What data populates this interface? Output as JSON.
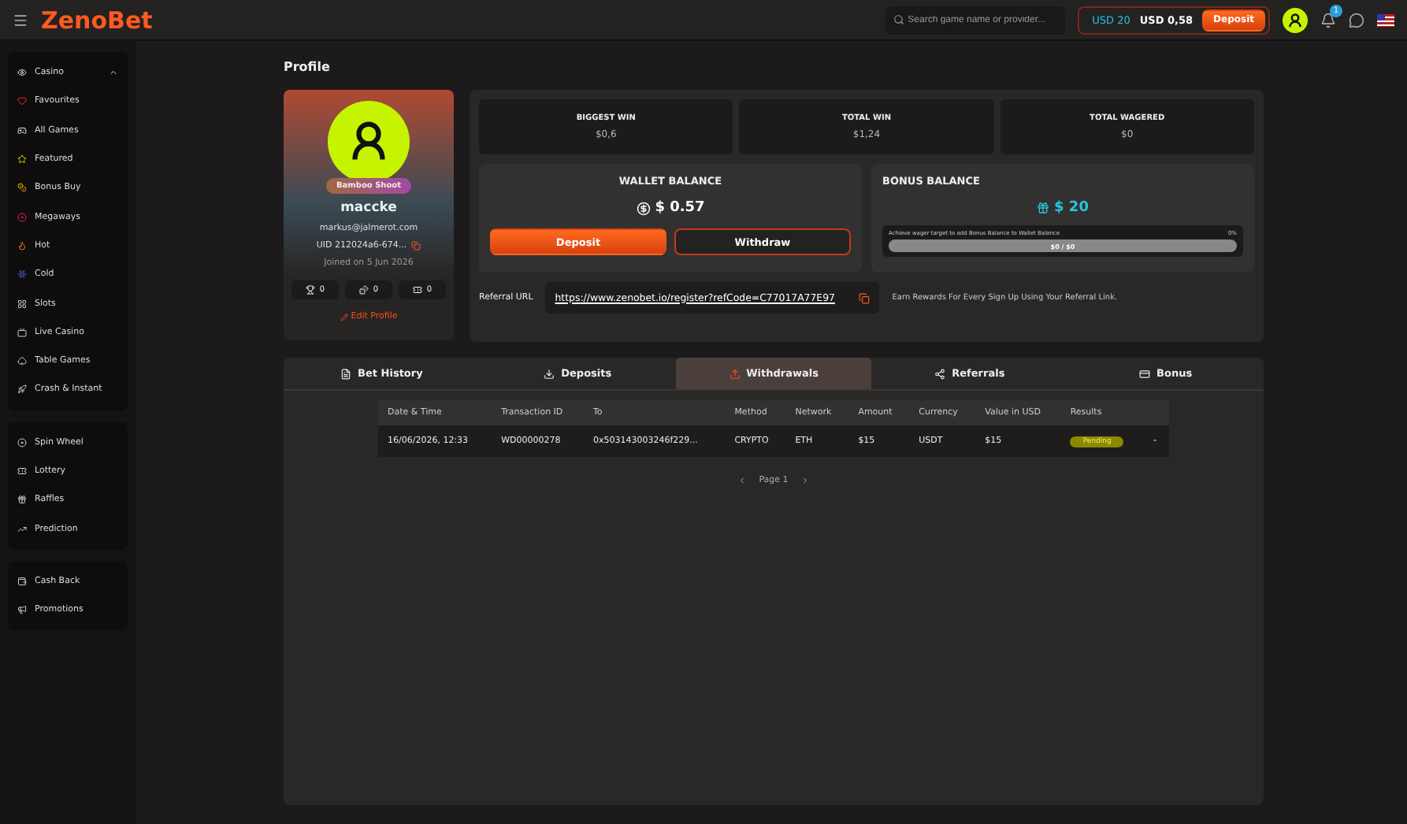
{
  "header": {
    "logo": "ZenoBet",
    "search": {
      "placeholder": "Search game name or provider..."
    },
    "bonus_balance": "USD 20",
    "wallet_balance": "USD 0,58",
    "deposit": "Deposit",
    "notifications": "1"
  },
  "sidebar": {
    "groups": [
      {
        "items": [
          {
            "label": "Casino",
            "expanded": true
          },
          {
            "label": "Favourites"
          },
          {
            "label": "All Games"
          },
          {
            "label": "Featured"
          },
          {
            "label": "Bonus Buy"
          },
          {
            "label": "Megaways"
          },
          {
            "label": "Hot"
          },
          {
            "label": "Cold"
          },
          {
            "label": "Slots"
          },
          {
            "label": "Live Casino"
          },
          {
            "label": "Table Games"
          },
          {
            "label": "Crash & Instant"
          }
        ]
      },
      {
        "items": [
          {
            "label": "Spin Wheel"
          },
          {
            "label": "Lottery"
          },
          {
            "label": "Raffles"
          },
          {
            "label": "Prediction"
          }
        ]
      },
      {
        "items": [
          {
            "label": "Cash Back"
          },
          {
            "label": "Promotions"
          }
        ]
      }
    ]
  },
  "page_title": "Profile",
  "profile": {
    "badge": "Bamboo Shoot",
    "username": "maccke",
    "email": "markus@jalmerot.com",
    "uid": "UID 212024a6-674...",
    "joined": "Joined on 5 Jun 2026",
    "counters": [
      "0",
      "0",
      "0"
    ],
    "edit": "Edit Profile"
  },
  "stats": [
    {
      "label": "BIGGEST WIN",
      "value": "$0,6"
    },
    {
      "label": "TOTAL WIN",
      "value": "$1,24"
    },
    {
      "label": "TOTAL WAGERED",
      "value": "$0"
    }
  ],
  "wallet": {
    "title": "WALLET BALANCE",
    "amount": "$ 0.57",
    "deposit": "Deposit",
    "withdraw": "Withdraw"
  },
  "bonus": {
    "title": "BONUS BALANCE",
    "amount": "$ 20",
    "hint": "Achieve wager target to add Bonus Balance to Wallet Balance",
    "percent": "0%",
    "progress": "$0 / $0"
  },
  "referral": {
    "label": "Referral URL",
    "url": "https://www.zenobet.io/register?refCode=C77017A77E97",
    "note": "Earn Rewards For Every Sign Up Using Your Referral Link."
  },
  "tabs": [
    {
      "label": "Bet History",
      "selected": false
    },
    {
      "label": "Deposits",
      "selected": false
    },
    {
      "label": "Withdrawals",
      "selected": true
    },
    {
      "label": "Referrals",
      "selected": false
    },
    {
      "label": "Bonus",
      "selected": false
    }
  ],
  "table": {
    "columns": [
      "Date & Time",
      "Transaction ID",
      "To",
      "Method",
      "Network",
      "Amount",
      "Currency",
      "Value in USD",
      "Results"
    ],
    "rows": [
      {
        "cells": [
          "16/06/2026, 12:33",
          "WD00000278",
          "0x503143003246f229...",
          "CRYPTO",
          "ETH",
          "$15",
          "USDT",
          "$15"
        ],
        "status": "Pending",
        "extra": "-"
      }
    ]
  },
  "pagination": {
    "label": "Page 1"
  }
}
